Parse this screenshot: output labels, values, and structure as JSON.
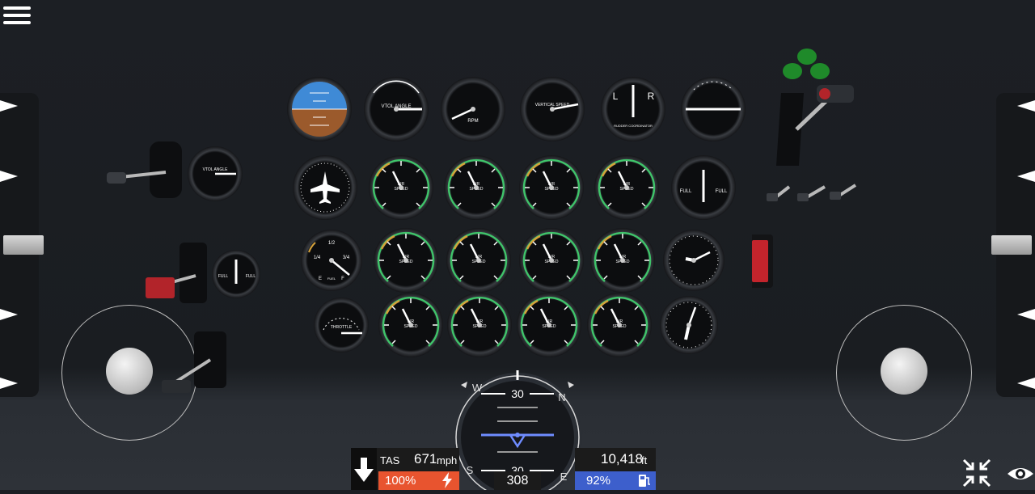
{
  "hud": {
    "tas_label": "TAS",
    "speed_value": "671",
    "speed_unit": "mph",
    "throttle_pct": "100%",
    "altitude_value": "10,418",
    "altitude_unit": "ft",
    "fuel_pct": "92%",
    "heading_value": "308",
    "pitch_ladder_top": "30",
    "pitch_ladder_bottom": "30",
    "compass_letters": [
      "W",
      "N",
      "S",
      "E"
    ]
  },
  "gauges": {
    "vtol_angle": "VTOL ANGLE",
    "rpm": "RPM",
    "vertical_speed": "VERTICAL SPEED",
    "rudder_l": "L",
    "rudder_r": "R",
    "rudder_label": "RUDDER COORDINATOR",
    "air_speed": "AIR SPEED",
    "fuel": "FUEL",
    "fuel_empty": "E",
    "fuel_full": "F",
    "fuel_half": "1/2",
    "fuel_quarter": "1/4",
    "fuel_three_quarter": "3/4",
    "throttle": "THROTTLE",
    "full": "FULL"
  },
  "colors": {
    "throttle_bar": "#e8542f",
    "fuel_bar": "#3d5fcc",
    "attitude_sky": "#3f8ad6",
    "attitude_ground": "#9b5a2c",
    "hud_horizon": "#6f8cff"
  },
  "icons": [
    "menu-icon",
    "arrow-down-icon",
    "lightning-icon",
    "fuel-pump-icon",
    "collapse-icon",
    "eye-icon"
  ]
}
